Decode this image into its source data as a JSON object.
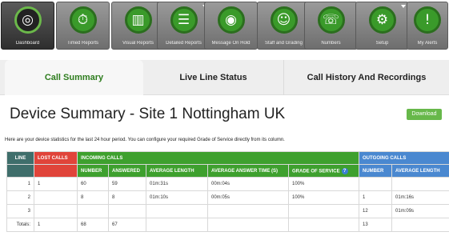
{
  "toolbar": {
    "buttons": [
      {
        "label": "Dashboard",
        "icon": "dashboard-icon",
        "glyph": "◎"
      },
      {
        "label": "Timed Reports",
        "icon": "stopwatch-icon",
        "glyph": "⏱"
      },
      {
        "label": "Visual Reports",
        "icon": "bar-chart-icon",
        "glyph": "▥"
      },
      {
        "label": "Detailed Reports",
        "icon": "report-list-icon",
        "glyph": "☰"
      },
      {
        "label": "Message On Hold",
        "icon": "speaker-icon",
        "glyph": "◉"
      },
      {
        "label": "Staff and Grading",
        "icon": "staff-icon",
        "glyph": "☺"
      },
      {
        "label": "Numbers",
        "icon": "phone-icon",
        "glyph": "☏"
      },
      {
        "label": "Setup",
        "icon": "gear-icon",
        "glyph": "⚙"
      },
      {
        "label": "My Alerts",
        "icon": "alert-icon",
        "glyph": "!"
      }
    ]
  },
  "tabs": [
    "Call Summary",
    "Live Line Status",
    "Call History And Recordings"
  ],
  "summary": {
    "title": "Device Summary - Site 1 Nottingham UK",
    "download_label": "Download",
    "description": "Here are your device statistics for the last 24 hour period. You can configure your required Grade of Service directly from its column."
  },
  "table": {
    "group_headers": {
      "line": "LINE",
      "lost": "LOST CALLS",
      "incoming": "INCOMING CALLS",
      "outgoing": "OUTGOING CALLS"
    },
    "sub_headers": {
      "in_number": "NUMBER",
      "in_answered": "ANSWERED",
      "in_avg_length": "AVERAGE LENGTH",
      "in_avg_answer": "AVERAGE ANSWER TIME (S)",
      "grade": "GRADE OF SERVICE",
      "out_number": "NUMBER",
      "out_avg_length": "AVERAGE LENGTH"
    },
    "rows": [
      {
        "line": "1",
        "lost": "1",
        "in_number": "60",
        "answered": "59",
        "avg_length": "01m:31s",
        "avg_answer": "00m:04s",
        "grade": "100%",
        "out_number": "",
        "out_avg_length": ""
      },
      {
        "line": "2",
        "lost": "",
        "in_number": "8",
        "answered": "8",
        "avg_length": "01m:10s",
        "avg_answer": "00m:05s",
        "grade": "100%",
        "out_number": "1",
        "out_avg_length": "01m:16s"
      },
      {
        "line": "3",
        "lost": "",
        "in_number": "",
        "answered": "",
        "avg_length": "",
        "avg_answer": "",
        "grade": "",
        "out_number": "12",
        "out_avg_length": "01m:09s"
      },
      {
        "line": "Totals:",
        "lost": "1",
        "in_number": "68",
        "answered": "67",
        "avg_length": "",
        "avg_answer": "",
        "grade": "",
        "out_number": "13",
        "out_avg_length": ""
      }
    ]
  }
}
